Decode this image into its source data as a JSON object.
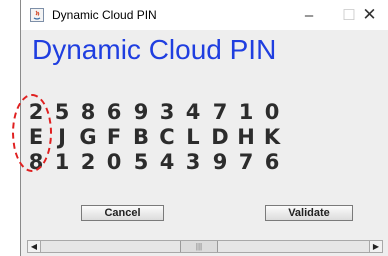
{
  "window": {
    "title": "Dynamic Cloud PIN",
    "minimize": "–",
    "maximize": "☐",
    "close": "✕"
  },
  "heading": "Dynamic Cloud PIN",
  "grid": {
    "row1": [
      "2",
      "5",
      "8",
      "6",
      "9",
      "3",
      "4",
      "7",
      "1",
      "0"
    ],
    "row2": [
      "E",
      "J",
      "G",
      "F",
      "B",
      "C",
      "L",
      "D",
      "H",
      "K"
    ],
    "row3": [
      "8",
      "1",
      "2",
      "0",
      "5",
      "4",
      "3",
      "9",
      "7",
      "6"
    ]
  },
  "buttons": {
    "cancel": "Cancel",
    "validate": "Validate"
  },
  "scrollbar": {
    "left_arrow": "◀",
    "right_arrow": "▶",
    "thumb_grip": "|||"
  },
  "colors": {
    "heading": "#1f3ee0",
    "highlight_circle": "#e02020"
  }
}
